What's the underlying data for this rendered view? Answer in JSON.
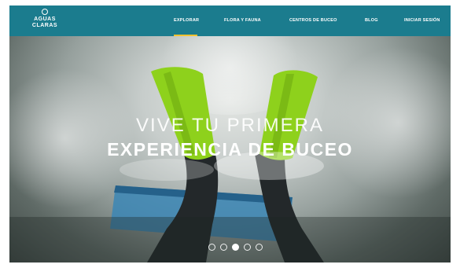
{
  "logo": {
    "line1": "AGUAS",
    "line2": "CLARAS",
    "icon": "circle-icon"
  },
  "nav": {
    "items": [
      {
        "label": "EXPLORAR",
        "active": true
      },
      {
        "label": "FLORA Y FAUNA",
        "active": false
      },
      {
        "label": "CENTROS DE BUCEO",
        "active": false
      },
      {
        "label": "BLOG",
        "active": false
      },
      {
        "label": "INICIAR SESIÓN",
        "active": false
      }
    ]
  },
  "hero": {
    "headline_line1": "VIVE TU PRIMERA",
    "headline_line2": "EXPERIENCIA DE BUCEO"
  },
  "carousel": {
    "slide_count": 5,
    "active_index": 2
  },
  "colors": {
    "navbar": "#1b7c8e",
    "accent_underline": "#f2c230",
    "fins": "#8ed11c",
    "board": "#3b86b5"
  }
}
